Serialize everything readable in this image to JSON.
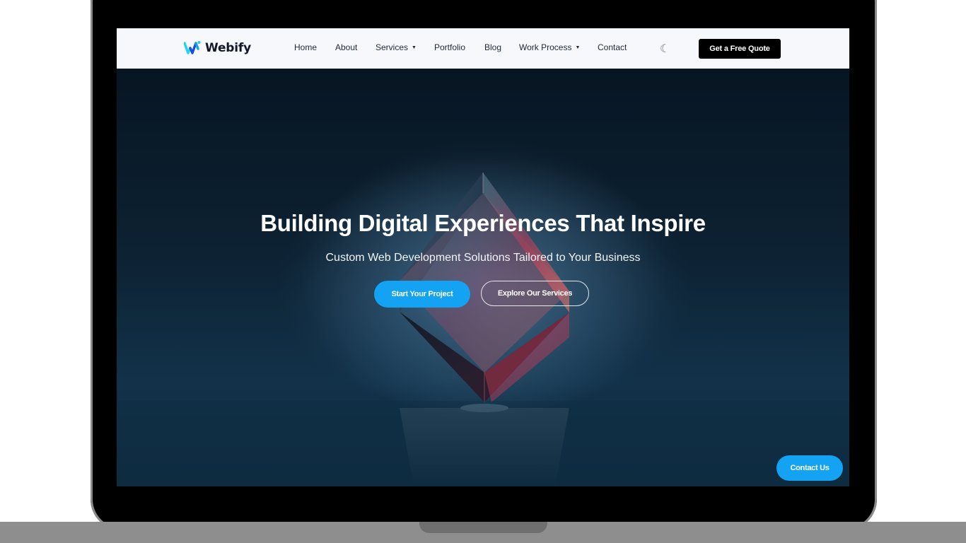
{
  "brand": {
    "name": "Webify",
    "logo_icon": "w-logo-icon",
    "colors": {
      "primary": "#13a3f2",
      "dark": "#000000",
      "nav_bg": "#f7f8fc"
    }
  },
  "nav": {
    "items": [
      {
        "label": "Home",
        "dropdown": false
      },
      {
        "label": "About",
        "dropdown": false
      },
      {
        "label": "Services",
        "dropdown": true
      },
      {
        "label": "Portfolio",
        "dropdown": false
      },
      {
        "label": "Blog",
        "dropdown": false
      },
      {
        "label": "Work Process",
        "dropdown": true
      },
      {
        "label": "Contact",
        "dropdown": false
      }
    ],
    "caret": "▼",
    "theme_toggle_icon": "☾",
    "cta_label": "Get a Free Quote"
  },
  "hero": {
    "title": "Building Digital Experiences That Inspire",
    "subtitle": "Custom Web Development Solutions Tailored to Your Business",
    "primary_button": "Start Your Project",
    "secondary_button": "Explore Our Services"
  },
  "floating": {
    "contact_label": "Contact Us"
  }
}
